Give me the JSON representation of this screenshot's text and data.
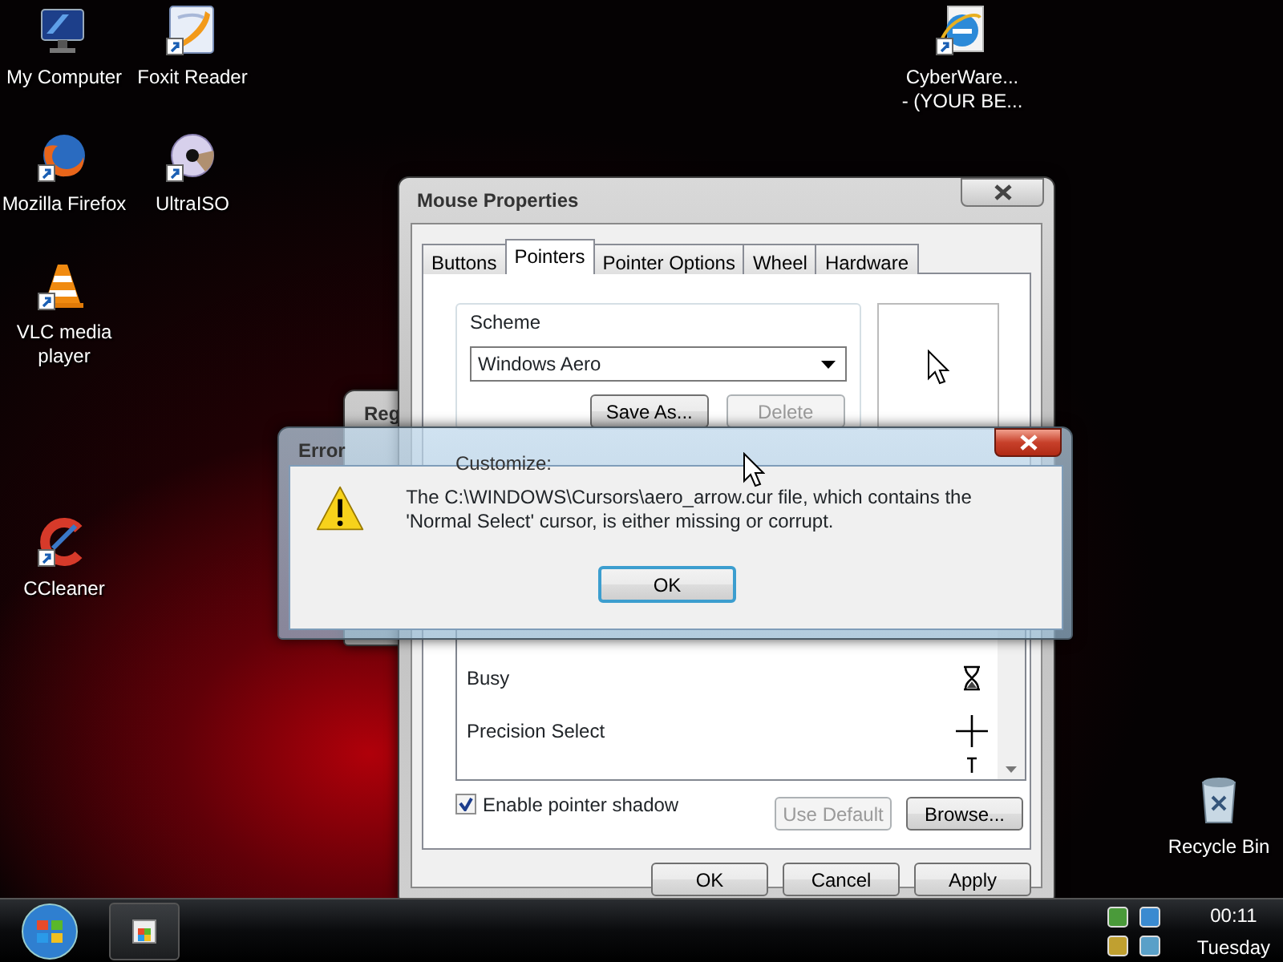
{
  "desktop_icons": [
    {
      "kind": "computer",
      "label": "My Computer",
      "shortcut": false
    },
    {
      "kind": "pdf",
      "label": "Foxit Reader",
      "shortcut": true
    },
    {
      "kind": "fox",
      "label": "Mozilla Firefox",
      "shortcut": true
    },
    {
      "kind": "disc",
      "label": "UltraISO",
      "shortcut": true
    },
    {
      "kind": "cone",
      "label": "VLC media player",
      "shortcut": true
    },
    {
      "kind": "cleaner",
      "label": "CCleaner",
      "shortcut": true
    },
    {
      "kind": "ie",
      "label": "CyberWare...\n- (YOUR BE...",
      "shortcut": true
    },
    {
      "kind": "bin",
      "label": "Recycle Bin",
      "shortcut": false
    }
  ],
  "background_window": {
    "title": "Reg"
  },
  "mouse_properties": {
    "title": "Mouse Properties",
    "tabs": [
      {
        "label": "Buttons",
        "selected": false
      },
      {
        "label": "Pointers",
        "selected": true
      },
      {
        "label": "Pointer Options",
        "selected": false
      },
      {
        "label": "Wheel",
        "selected": false
      },
      {
        "label": "Hardware",
        "selected": false
      }
    ],
    "scheme": {
      "legend": "Scheme",
      "value": "Windows Aero",
      "buttons": [
        {
          "label": "Save As...",
          "disabled": false
        },
        {
          "label": "Delete",
          "disabled": true
        }
      ]
    },
    "customize_label": "Customize:",
    "cursor_rows": [
      {
        "kind": "busy",
        "label": "Busy"
      },
      {
        "kind": "precision",
        "label": "Precision Select"
      },
      {
        "kind": "text"
      }
    ],
    "shadow": {
      "label": "Enable pointer shadow",
      "checked": true
    },
    "list_buttons": [
      {
        "label": "Use Default",
        "disabled": true
      },
      {
        "label": "Browse...",
        "disabled": false
      }
    ],
    "footer_buttons": [
      {
        "label": "OK"
      },
      {
        "label": "Cancel"
      },
      {
        "label": "Apply"
      }
    ]
  },
  "error_dialog": {
    "title": "Error",
    "message": "The C:\\WINDOWS\\Cursors\\aero_arrow.cur file, which contains the 'Normal Select' cursor, is either missing or corrupt.",
    "button": "OK"
  },
  "taskbar": {
    "time": "00:11",
    "day": "Tuesday"
  }
}
